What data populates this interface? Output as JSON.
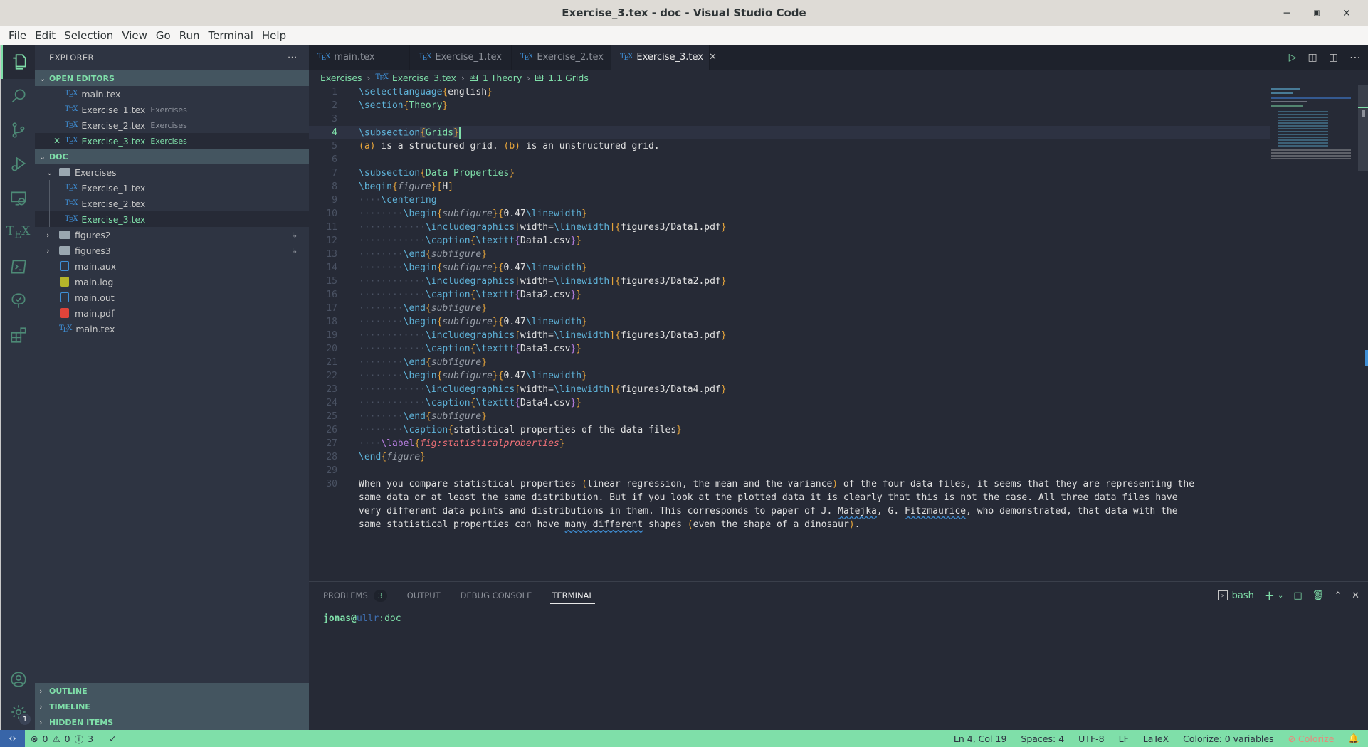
{
  "window": {
    "title": "Exercise_3.tex - doc - Visual Studio Code"
  },
  "menu": [
    "File",
    "Edit",
    "Selection",
    "View",
    "Go",
    "Run",
    "Terminal",
    "Help"
  ],
  "explorer": {
    "title": "EXPLORER",
    "open_editors": {
      "label": "OPEN EDITORS",
      "items": [
        {
          "name": "main.tex",
          "desc": ""
        },
        {
          "name": "Exercise_1.tex",
          "desc": "Exercises"
        },
        {
          "name": "Exercise_2.tex",
          "desc": "Exercises"
        },
        {
          "name": "Exercise_3.tex",
          "desc": "Exercises"
        }
      ]
    },
    "workspace": {
      "label": "DOC",
      "folder": "Exercises",
      "folder_items": [
        "Exercise_1.tex",
        "Exercise_2.tex",
        "Exercise_3.tex"
      ],
      "folders": [
        "figures2",
        "figures3"
      ],
      "files": [
        "main.aux",
        "main.log",
        "main.out",
        "main.pdf",
        "main.tex"
      ]
    },
    "bottom_sections": [
      "OUTLINE",
      "TIMELINE",
      "HIDDEN ITEMS"
    ]
  },
  "activity": {
    "settings_badge": "1"
  },
  "tabs": [
    {
      "label": "main.tex"
    },
    {
      "label": "Exercise_1.tex"
    },
    {
      "label": "Exercise_2.tex"
    },
    {
      "label": "Exercise_3.tex"
    }
  ],
  "breadcrumb": [
    "Exercises",
    "Exercise_3.tex",
    "1 Theory",
    "1.1 Grids"
  ],
  "editor": {
    "current_line": 4,
    "lines": [
      {
        "n": "1"
      },
      {
        "n": "2"
      },
      {
        "n": "3"
      },
      {
        "n": "4"
      },
      {
        "n": "5"
      },
      {
        "n": "6"
      },
      {
        "n": "7"
      },
      {
        "n": "8"
      },
      {
        "n": "9"
      },
      {
        "n": "10"
      },
      {
        "n": "11"
      },
      {
        "n": "12"
      },
      {
        "n": "13"
      },
      {
        "n": "14"
      },
      {
        "n": "15"
      },
      {
        "n": "16"
      },
      {
        "n": "17"
      },
      {
        "n": "18"
      },
      {
        "n": "19"
      },
      {
        "n": "20"
      },
      {
        "n": "21"
      },
      {
        "n": "22"
      },
      {
        "n": "23"
      },
      {
        "n": "24"
      },
      {
        "n": "25"
      },
      {
        "n": "26"
      },
      {
        "n": "27"
      },
      {
        "n": "28"
      },
      {
        "n": "29"
      },
      {
        "n": "30"
      }
    ],
    "text": {
      "l1_cmd": "\\selectlanguage",
      "l1_arg": "english",
      "l2_cmd": "\\section",
      "l2_arg": "Theory",
      "l4_cmd": "\\subsection",
      "l4_arg": "Grids",
      "l5": "is a structured grid.",
      "l5_a": "(a)",
      "l5_b": "(b)",
      "l5_rest": "is an unstructured grid.",
      "l7_cmd": "\\subsection",
      "l7_arg": "Data Properties",
      "l8_cmd": "\\begin",
      "l8_env": "figure",
      "l8_opt": "H",
      "l9_cmd": "\\centering",
      "begin": "\\begin",
      "end": "\\end",
      "subfigure": "subfigure",
      "width_arg": "0.47",
      "linewidth": "\\linewidth",
      "includegraphics": "\\includegraphics",
      "width_opt": "width=",
      "caption": "\\caption",
      "texttt": "\\texttt",
      "fig1": "figures3/Data1.pdf",
      "fig2": "figures3/Data2.pdf",
      "fig3": "figures3/Data3.pdf",
      "fig4": "figures3/Data4.pdf",
      "csv1": "Data1.csv",
      "csv2": "Data2.csv",
      "csv3": "Data3.csv",
      "csv4": "Data4.csv",
      "l26_arg": "statistical properties of the data files",
      "l27_cmd": "\\label",
      "l27_arg": "fig:statisticalproberties",
      "l28_env": "figure",
      "p1a": "When you compare statistical properties ",
      "p1b": "linear regression, the mean and the variance",
      "p1c": " of the four data files, it seems that they are representing the",
      "p2": "same data or at least the same distribution. But if you look at the plotted data it is clearly that this is not the case. All three data files have",
      "p3a": "very different data points and distributions in them. This corresponds to paper of J. ",
      "p3b": "Matejka",
      "p3c": ", G. ",
      "p3d": "Fitzmaurice",
      "p3e": ", who demonstrated, that data with the",
      "p4a": "same statistical properties can have ",
      "p4b": "many different",
      "p4c": " shapes ",
      "p4d": "even the shape of a dinosaur",
      "p4e": "."
    }
  },
  "panel": {
    "tabs": [
      {
        "label": "PROBLEMS",
        "badge": "3"
      },
      {
        "label": "OUTPUT"
      },
      {
        "label": "DEBUG CONSOLE"
      },
      {
        "label": "TERMINAL"
      }
    ],
    "shell": "bash",
    "prompt_user": "jonas@",
    "prompt_host": "ullr",
    "prompt_dir": ":doc"
  },
  "status": {
    "errors": "0",
    "warnings": "0",
    "info": "3",
    "position": "Ln 4, Col 19",
    "spaces": "Spaces: 4",
    "encoding": "UTF-8",
    "eol": "LF",
    "language": "LaTeX",
    "colorize_vars": "Colorize: 0 variables",
    "colorize": "Colorize"
  },
  "colors": {
    "accent": "#7fdfa9",
    "remote": "#3865a8"
  }
}
